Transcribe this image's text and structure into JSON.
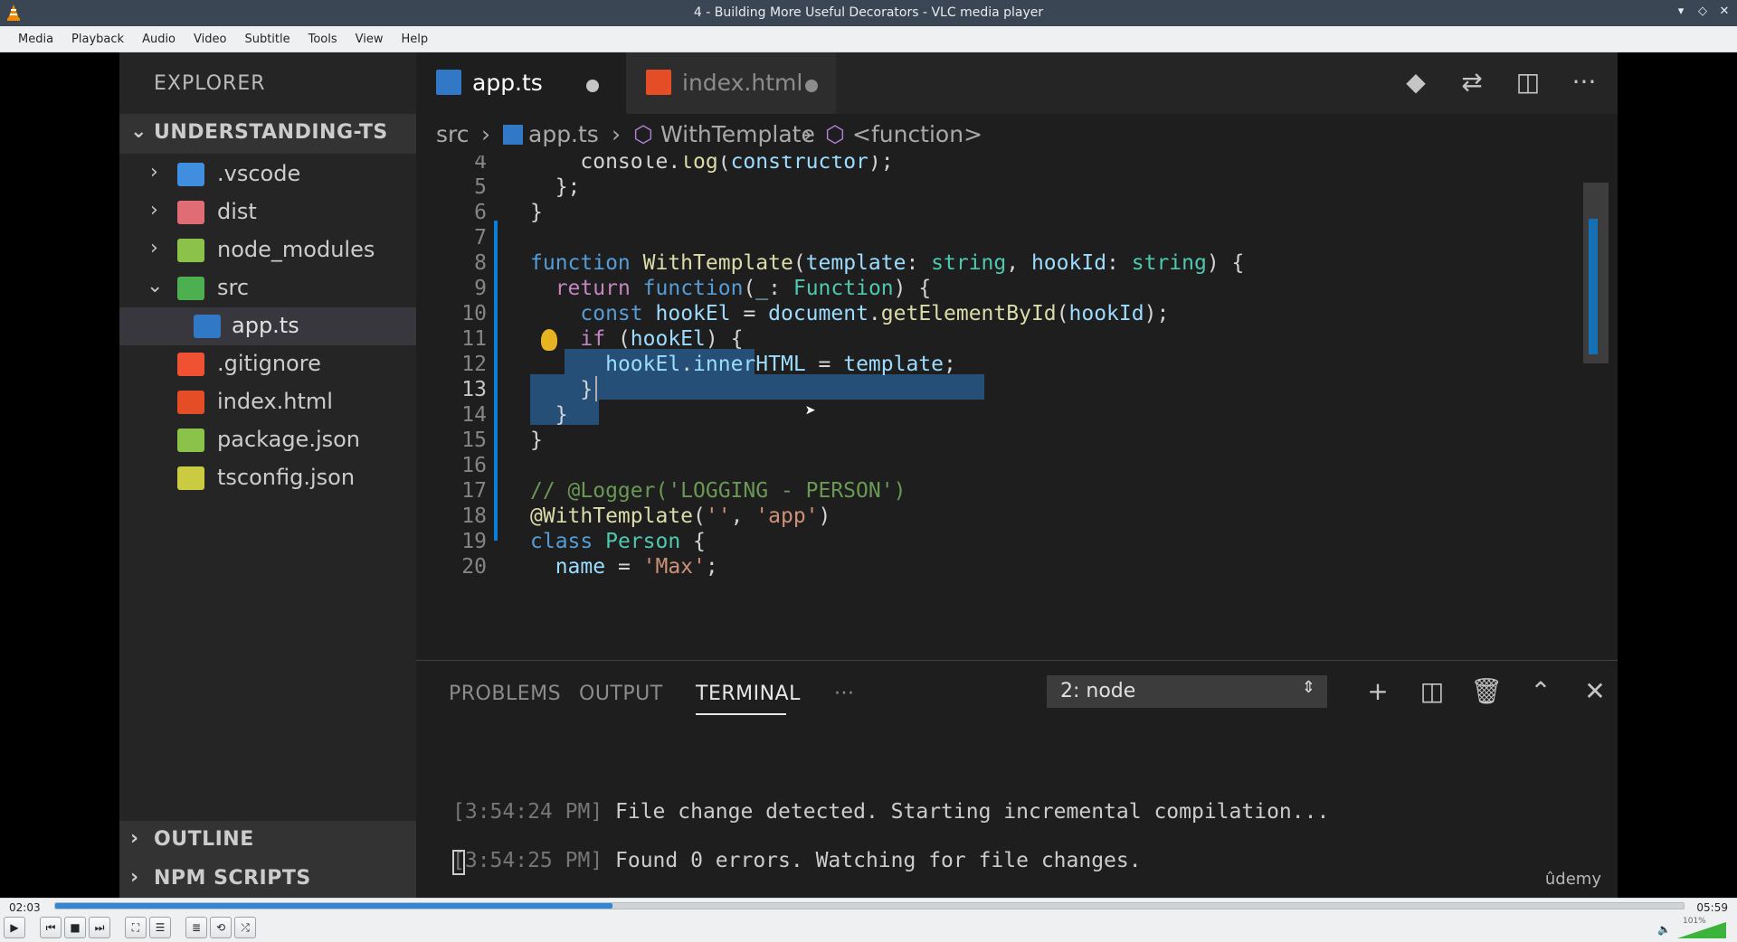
{
  "window": {
    "title": "4 - Building More Useful Decorators - VLC media player",
    "controls": [
      "▾",
      "◇",
      "✕"
    ]
  },
  "menu": [
    "Media",
    "Playback",
    "Audio",
    "Video",
    "Subtitle",
    "Tools",
    "View",
    "Help"
  ],
  "player": {
    "elapsed": "02:03",
    "total": "05:59",
    "progress": 0.342,
    "volume_label": "101%",
    "volume": 1.01
  },
  "vscode": {
    "explorer_title": "EXPLORER",
    "project": "UNDERSTANDING-TS",
    "tree": [
      {
        "label": ".vscode",
        "type": "folder",
        "expanded": false,
        "color": "#3f8ee0"
      },
      {
        "label": "dist",
        "type": "folder",
        "expanded": false,
        "color": "#e06c75"
      },
      {
        "label": "node_modules",
        "type": "folder",
        "expanded": false,
        "color": "#8bc34a"
      },
      {
        "label": "src",
        "type": "folder",
        "expanded": true,
        "color": "#4caf50"
      },
      {
        "label": "app.ts",
        "type": "file",
        "selected": true,
        "color": "#3178c6"
      },
      {
        "label": ".gitignore",
        "type": "file",
        "color": "#f05133"
      },
      {
        "label": "index.html",
        "type": "file",
        "color": "#e44d26"
      },
      {
        "label": "package.json",
        "type": "file",
        "color": "#8bc34a"
      },
      {
        "label": "tsconfig.json",
        "type": "file",
        "color": "#cbcb41"
      }
    ],
    "outline": "OUTLINE",
    "npm_scripts": "NPM SCRIPTS",
    "tabs": [
      {
        "label": "app.ts",
        "active": true,
        "icon": "TS"
      },
      {
        "label": "index.html",
        "active": false,
        "icon": "5"
      }
    ],
    "breadcrumb": [
      "src",
      "app.ts",
      "WithTemplate",
      "<function>"
    ],
    "gutter": [
      "4",
      "5",
      "6",
      "7",
      "8",
      "9",
      "10",
      "11",
      "12",
      "13",
      "14",
      "15",
      "16",
      "17",
      "18",
      "19",
      "20"
    ],
    "panel": {
      "tabs": [
        "PROBLEMS",
        "OUTPUT",
        "TERMINAL",
        "···"
      ],
      "terminal_select": "2: node",
      "lines": [
        {
          "time": "[3:54:24 PM]",
          "msg": " File change detected. Starting incremental compilation..."
        },
        {
          "time": "[3:54:25 PM]",
          "msg": " Found 0 errors. Watching for file changes."
        }
      ]
    },
    "watermark": "ûdemy"
  }
}
